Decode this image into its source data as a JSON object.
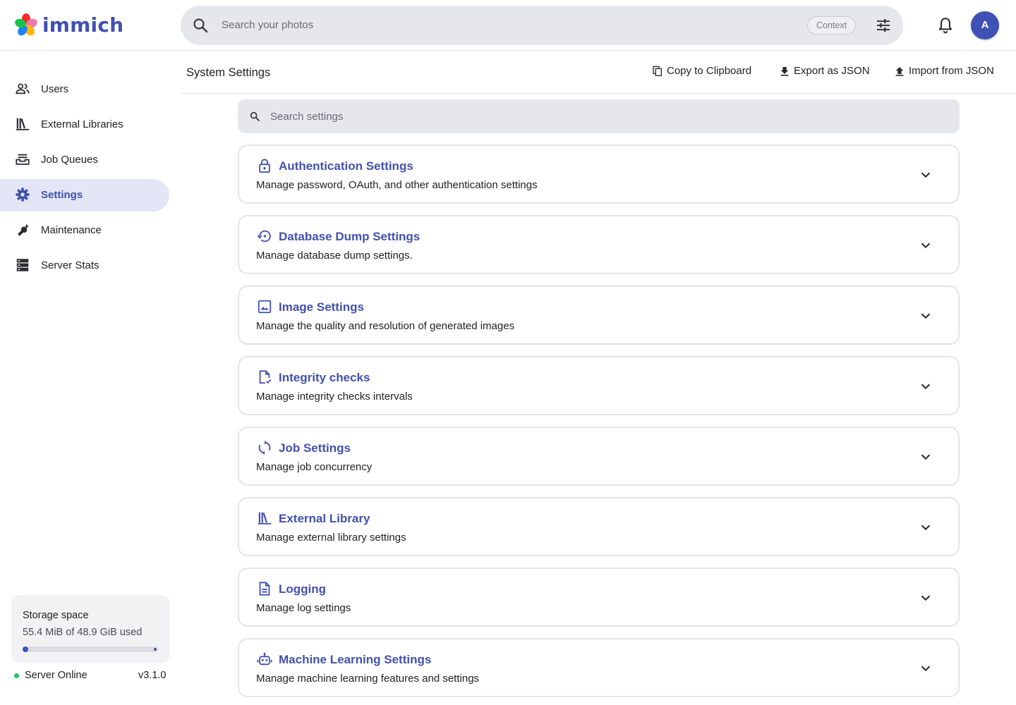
{
  "app": {
    "name": "immich",
    "brand_color": "#4250af"
  },
  "header": {
    "search_placeholder": "Search your photos",
    "context_label": "Context",
    "user_initial": "A"
  },
  "sidebar": {
    "items": [
      {
        "label": "Users",
        "icon": "users-icon",
        "active": false
      },
      {
        "label": "External Libraries",
        "icon": "library-icon",
        "active": false
      },
      {
        "label": "Job Queues",
        "icon": "tray-icon",
        "active": false
      },
      {
        "label": "Settings",
        "icon": "gear-icon",
        "active": true
      },
      {
        "label": "Maintenance",
        "icon": "wrench-icon",
        "active": false
      },
      {
        "label": "Server Stats",
        "icon": "server-icon",
        "active": false
      }
    ],
    "storage": {
      "title": "Storage space",
      "used_text": "55.4 MiB of 48.9 GiB used",
      "used_fraction": 0.0011
    },
    "server_status": "Server Online",
    "version": "v3.1.0"
  },
  "main": {
    "title": "System Settings",
    "actions": {
      "copy": "Copy to Clipboard",
      "export": "Export as JSON",
      "import": "Import from JSON"
    },
    "search_placeholder": "Search settings",
    "sections": [
      {
        "title": "Authentication Settings",
        "desc": "Manage password, OAuth, and other authentication settings",
        "icon": "lock-icon"
      },
      {
        "title": "Database Dump Settings",
        "desc": "Manage database dump settings.",
        "icon": "backup-restore-icon"
      },
      {
        "title": "Image Settings",
        "desc": "Manage the quality and resolution of generated images",
        "icon": "image-icon"
      },
      {
        "title": "Integrity checks",
        "desc": "Manage integrity checks intervals",
        "icon": "file-check-icon"
      },
      {
        "title": "Job Settings",
        "desc": "Manage job concurrency",
        "icon": "sync-icon"
      },
      {
        "title": "External Library",
        "desc": "Manage external library settings",
        "icon": "library-icon"
      },
      {
        "title": "Logging",
        "desc": "Manage log settings",
        "icon": "file-document-icon"
      },
      {
        "title": "Machine Learning Settings",
        "desc": "Manage machine learning features and settings",
        "icon": "robot-icon"
      }
    ]
  }
}
